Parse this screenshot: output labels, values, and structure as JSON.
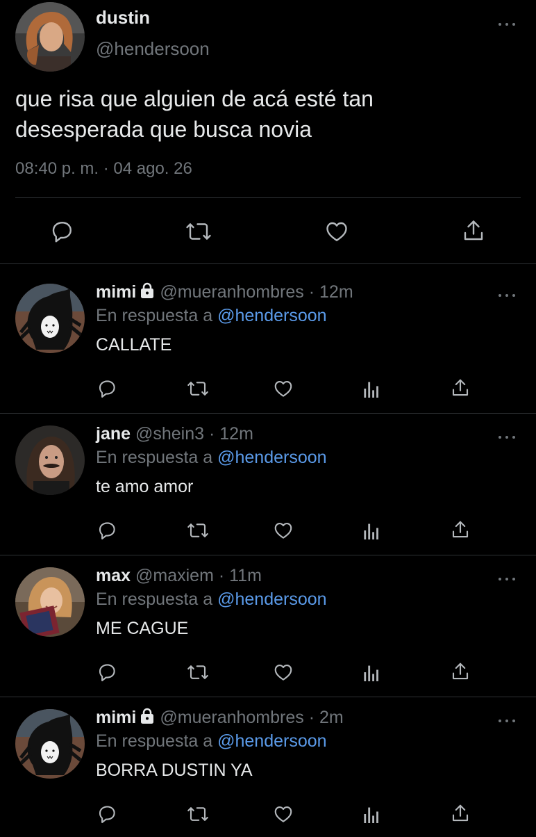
{
  "main_tweet": {
    "name": "dustin",
    "handle": "@hendersoon",
    "text_line1": "que risa que alguien de acá esté tan",
    "text_line2": "desesperada que busca novia",
    "timestamp": "08:40 p. m. · 04 ago. 26"
  },
  "replies": [
    {
      "name": "mimi",
      "locked": true,
      "handle": "@mueranhombres",
      "time": "· 12m",
      "reply_prefix": "En respuesta a",
      "mention": "@hendersoon",
      "text": "CALLATE"
    },
    {
      "name": "jane",
      "locked": false,
      "handle": "@shein3",
      "time": "· 12m",
      "reply_prefix": "En respuesta a",
      "mention": "@hendersoon",
      "text": "te amo amor"
    },
    {
      "name": "max",
      "locked": false,
      "handle": "@maxiem",
      "time": "· 11m",
      "reply_prefix": "En respuesta a",
      "mention": "@hendersoon",
      "text": "ME CAGUE"
    },
    {
      "name": "mimi",
      "locked": true,
      "handle": "@mueranhombres",
      "time": "· 2m",
      "reply_prefix": "En respuesta a",
      "mention": "@hendersoon",
      "text": "BORRA DUSTIN YA"
    }
  ],
  "colors": {
    "background": "#000000",
    "text": "#e7e9ea",
    "muted": "#71767b",
    "link": "#5b9bea",
    "divider": "#2f3336"
  },
  "icons": [
    "more-icon",
    "reply-icon",
    "retweet-icon",
    "like-icon",
    "share-icon",
    "analytics-icon",
    "lock-icon"
  ]
}
